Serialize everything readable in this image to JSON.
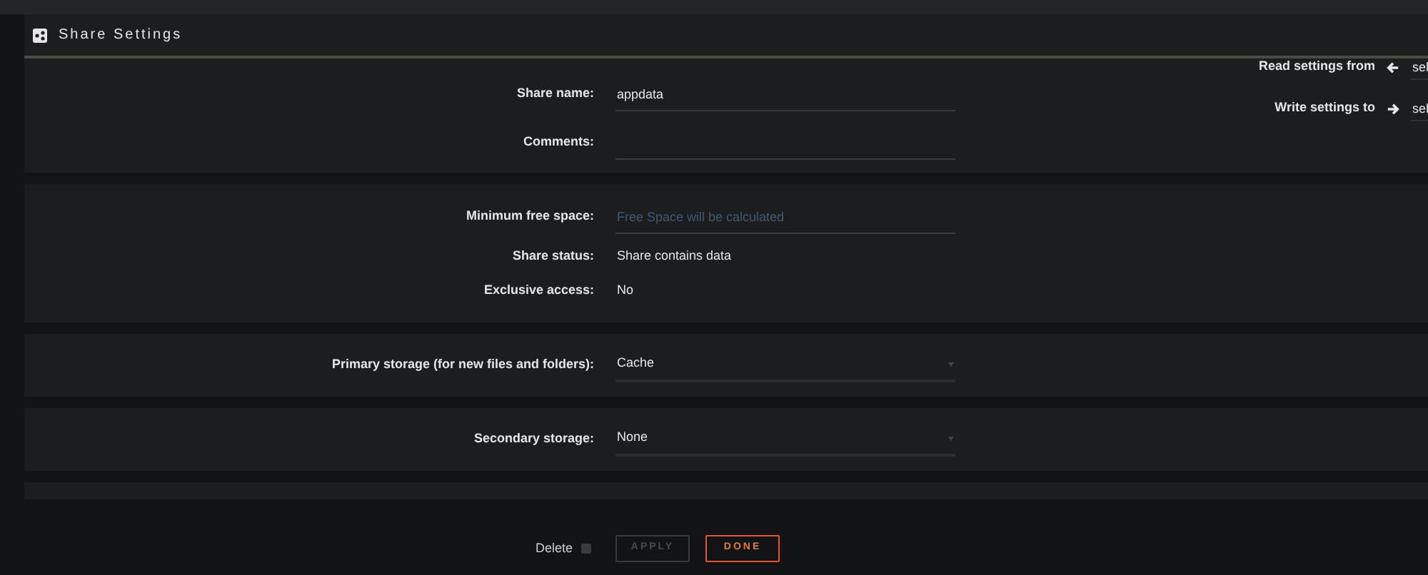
{
  "panel": {
    "title": "Share Settings"
  },
  "copy_settings": [
    {
      "label": "Read settings from",
      "kind": "read",
      "value": "sel"
    },
    {
      "label": "Write settings to",
      "kind": "write",
      "value": "sel"
    }
  ],
  "sections": [
    {
      "rows": [
        {
          "kind": "input",
          "label": "Share name:",
          "value": "appdata"
        },
        {
          "kind": "input",
          "label": "Comments:"
        }
      ]
    },
    {
      "rows": [
        {
          "kind": "input",
          "label": "Minimum free space:",
          "placeholder": "Free Space will be calculated"
        },
        {
          "kind": "text",
          "label": "Share status:",
          "value": "Share contains data"
        },
        {
          "kind": "text",
          "label": "Exclusive access:",
          "value": "No"
        }
      ]
    },
    {
      "rows": [
        {
          "kind": "select",
          "label": "Primary storage (for new files and folders):",
          "value": "Cache"
        }
      ]
    },
    {
      "rows": [
        {
          "kind": "select",
          "label": "Secondary storage:",
          "value": "None"
        }
      ]
    }
  ],
  "footer": {
    "delete": {
      "label": "Delete",
      "checked": false
    },
    "buttons": [
      {
        "label": "APPLY",
        "disabled": true
      },
      {
        "label": "DONE",
        "disabled": false
      }
    ]
  }
}
